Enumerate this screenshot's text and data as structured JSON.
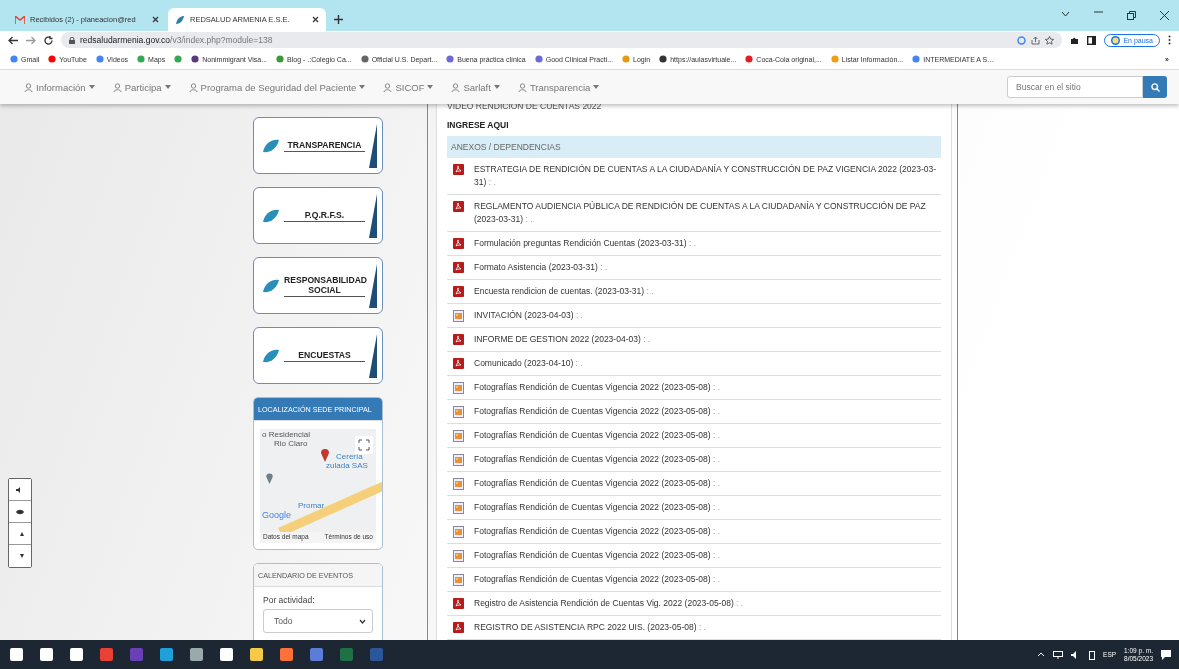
{
  "browser": {
    "tabs": [
      {
        "label": "Recibidos (2) - planeacion@red",
        "selected": false
      },
      {
        "label": "REDSALUD ARMENIA E.S.E.",
        "selected": true
      }
    ],
    "url_host": "redsaludarmenia.gov.co",
    "url_path": "/v3/index.php?module=138",
    "profile": "En pausa",
    "bookmarks": [
      "Gmail",
      "YouTube",
      "Videos",
      "Maps",
      "Nonimmigrant Visa...",
      "Blog - .:Colegio Ca...",
      "Official U.S. Depart...",
      "Buena práctica clínica",
      "Good Clinical Practi...",
      "Login",
      "https://aulasvirtuale...",
      "Coca-Cola original,...",
      "Listar Información...",
      "INTERMEDIATE A S..."
    ],
    "more": "»"
  },
  "nav": {
    "items": [
      "Información",
      "Participa",
      "Programa de Seguridad del Paciente",
      "SICOF",
      "Sarlaft",
      "Transparencia"
    ],
    "search_placeholder": "Buscar en el sitio"
  },
  "sidebar": {
    "cards": [
      "TRANSPARENCIA",
      "P.Q.R.F.S.",
      "RESPONSABILIDAD SOCIAL",
      "ENCUESTAS"
    ],
    "location": {
      "title": "LOCALIZACIÓN SEDE PRINCIPAL",
      "labels": [
        "o Residencial",
        "Rio Claro",
        "Cerería",
        "zulada SAS",
        "Promar"
      ],
      "google": "Google",
      "data": "Datos del mapa",
      "terms": "Términos de uso"
    },
    "calendar": {
      "title": "CALENDARIO DE EVENTOS",
      "label": "Por actividad:",
      "value": "Todo"
    }
  },
  "content": {
    "video_title": "VIDEO RENDICION DE CUENTAS 2022",
    "link": "INGRESE AQUI",
    "section": "ANEXOS / DEPENDENCIAS",
    "files": [
      {
        "kind": "pdf",
        "title": "ESTRATEGIA DE RENDICIÓN DE CUENTAS A LA CIUDADANÍA Y CONSTRUCCIÓN DE PAZ VIGENCIA 2022 (2023-03-31)",
        "suffix": ": ."
      },
      {
        "kind": "pdf",
        "title": "REGLAMENTO AUDIENCIA PÚBLICA DE RENDICIÓN DE CUENTAS A LA CIUDADANÍA Y CONSTRUCCIÓN DE PAZ (2023-03-31)",
        "suffix": ": ."
      },
      {
        "kind": "pdf",
        "title": "Formulación preguntas Rendición Cuentas (2023-03-31)",
        "suffix": ": ."
      },
      {
        "kind": "pdf",
        "title": "Formato Asistencia (2023-03-31)",
        "suffix": ": ."
      },
      {
        "kind": "pdf",
        "title": "Encuesta rendicion de cuentas. (2023-03-31)",
        "suffix": ": ."
      },
      {
        "kind": "image",
        "title": "INVITACIÓN (2023-04-03)",
        "suffix": ": ."
      },
      {
        "kind": "pdf",
        "title": "INFORME DE GESTION 2022 (2023-04-03)",
        "suffix": ": ."
      },
      {
        "kind": "pdf",
        "title": "Comunicado (2023-04-10)",
        "suffix": ": ."
      },
      {
        "kind": "image",
        "title": "Fotografías Rendición de Cuentas Vigencia 2022 (2023-05-08)",
        "suffix": ": ."
      },
      {
        "kind": "image",
        "title": "Fotografías Rendición de Cuentas Vigencia 2022 (2023-05-08)",
        "suffix": ": ."
      },
      {
        "kind": "image",
        "title": "Fotografías Rendición de Cuentas Vigencia 2022 (2023-05-08)",
        "suffix": ": ."
      },
      {
        "kind": "image",
        "title": "Fotografías Rendición de Cuentas Vigencia 2022 (2023-05-08)",
        "suffix": ": ."
      },
      {
        "kind": "image",
        "title": "Fotografías Rendición de Cuentas Vigencia 2022 (2023-05-08)",
        "suffix": ": ."
      },
      {
        "kind": "image",
        "title": "Fotografías Rendición de Cuentas Vigencia 2022 (2023-05-08)",
        "suffix": ": ."
      },
      {
        "kind": "image",
        "title": "Fotografías Rendición de Cuentas Vigencia 2022 (2023-05-08)",
        "suffix": ": ."
      },
      {
        "kind": "image",
        "title": "Fotografías Rendición de Cuentas Vigencia 2022 (2023-05-08)",
        "suffix": ": ."
      },
      {
        "kind": "image",
        "title": "Fotografías Rendición de Cuentas Vigencia 2022 (2023-05-08)",
        "suffix": ": ."
      },
      {
        "kind": "pdf",
        "title": "Registro de Asistencia Rendición de Cuentas Vig. 2022 (2023-05-08)",
        "suffix": ": ."
      },
      {
        "kind": "pdf",
        "title": "REGISTRO DE ASISTENCIA RPC 2022 UIS. (2023-05-08)",
        "suffix": ": ."
      }
    ]
  },
  "taskbar": {
    "lang": "ESP",
    "time": "1:09 p. m.",
    "date": "8/05/2023"
  }
}
